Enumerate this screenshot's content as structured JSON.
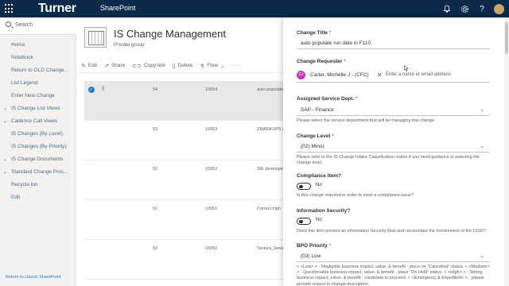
{
  "suite_bar": {
    "brand": "Turner",
    "app_name": "SharePoint",
    "icons": [
      "waffle-icon",
      "bell-icon",
      "gear-icon",
      "help-icon",
      "avatar"
    ]
  },
  "left_nav": {
    "search_placeholder": "Search",
    "items": [
      {
        "label": "Home",
        "chevron": false
      },
      {
        "label": "Notebook",
        "chevron": false
      },
      {
        "label": "Return to OLD Change...",
        "chevron": false
      },
      {
        "label": "List Legend",
        "chevron": false
      },
      {
        "label": "Enter New Change",
        "chevron": false
      },
      {
        "label": "IS Change List Views",
        "chevron": true
      },
      {
        "label": "Cadence Call Views",
        "chevron": true
      },
      {
        "label": "IS Changes (By Level)",
        "chevron": false
      },
      {
        "label": "IS Changes (By Priority)",
        "chevron": false
      },
      {
        "label": "IS Change Documents",
        "chevron": true
      },
      {
        "label": "Standard Change Proc...",
        "chevron": true
      },
      {
        "label": "Recycle bin",
        "chevron": false
      },
      {
        "label": "Edit",
        "chevron": false
      }
    ],
    "return_classic": "Return to classic SharePoint"
  },
  "site_header": {
    "title": "IS Change Management",
    "subtitle": "Private group"
  },
  "command_bar": {
    "edit": "Edit",
    "share": "Share",
    "copy_link": "Copy link",
    "delete": "Delete",
    "flow": "Flow",
    "more": "···"
  },
  "list": {
    "rows": [
      {
        "c1": "54",
        "c2": "10054",
        "c3": "auto populate",
        "selected": true
      },
      {
        "c1": "53",
        "c2": "10053",
        "c3": "ZMARKUPS d",
        "selected": false
      },
      {
        "c1": "52",
        "c2": "10052",
        "c3": "SIE developm",
        "selected": false
      },
      {
        "c1": "51",
        "c2": "10051",
        "c3": "Correct high",
        "selected": false
      },
      {
        "c1": "50",
        "c2": "10050",
        "c3": "Textura_Revie",
        "selected": false
      }
    ]
  },
  "panel": {
    "change_title": {
      "label": "Change Title",
      "value": "auto populate run date in F110"
    },
    "change_requester": {
      "label": "Change Requester",
      "person": "Carter, Michelle J - (CFC)",
      "initials": "CJ",
      "placeholder": "Enter a name or email address"
    },
    "service_dept": {
      "label": "Assigned Service Dept.",
      "value": "SAP - Finance",
      "help": "Please select the service department that will be managing this change."
    },
    "change_level": {
      "label": "Change Level",
      "value": "(02) Minor",
      "help": "Please refer to the IS Change Intake Classification matrix if you need guidance in selecting the change level."
    },
    "compliance": {
      "label": "Compliance Item?",
      "state": "No",
      "help": "Is this change required in order to meet a compliance issue?"
    },
    "info_security": {
      "label": "Information Security?",
      "state": "No",
      "help": "Does this item present an information Security Risk and necessitate the involvement of the CISO?"
    },
    "bpo_priority": {
      "label": "BPO Priority",
      "value": "(03) Low",
      "help": "< <Low> > - Negligible business impact, value, & benefit - place on \"Cancelled\" status. < <Medium> > - Questionable business impact, value, & benefit - place \"On Hold\" status. < <High> > - Strong business impact, value, & benefit - candidate to proceed. < <Emergency & Expedited> > - please provide reason in change description."
    }
  },
  "colors": {
    "suite_bar": "#0b2a4a",
    "accent": "#2b78c5",
    "persona": "#c239b3",
    "required": "#a4262c"
  }
}
